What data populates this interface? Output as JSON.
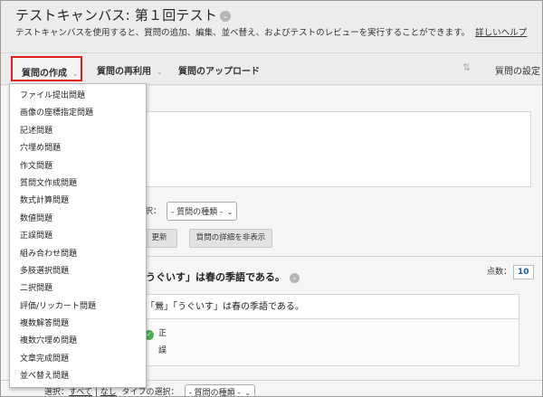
{
  "header": {
    "title": "テストキャンバス: 第１回テスト",
    "subtitle": "テストキャンバスを使用すると、質問の追加、編集、並べ替え、およびテストのレビューを実行することができます。",
    "help_link": "詳しいヘルプ"
  },
  "toolbar": {
    "create_question": "質問の作成",
    "reuse_question": "質問の再利用",
    "upload_questions": "質問のアップロード",
    "sort_icon": "⇅",
    "question_settings": "質問の設定"
  },
  "dropdown": {
    "items": [
      "ファイル提出問題",
      "画像の座標指定問題",
      "記述問題",
      "穴埋め問題",
      "作文問題",
      "質問文作成問題",
      "数式計算問題",
      "数値問題",
      "正誤問題",
      "組み合わせ問題",
      "多肢選択問題",
      "二択問題",
      "評価/リッカート問題",
      "複数解答問題",
      "複数穴埋め問題",
      "文章完成問題",
      "並べ替え問題"
    ]
  },
  "filter": {
    "type_label_partial": "の選択：",
    "type_select": "- 質問の種類 -",
    "update_button": "更新",
    "hide_details_button": "質問の詳細を非表示"
  },
  "question": {
    "title_partial": "「うぐいす」は春の季語である。",
    "points_label": "点数：",
    "points_value": "10",
    "body_partial": "「鶯」「うぐいす」は春の季語である。",
    "answers": [
      "正",
      "誤"
    ]
  },
  "bottom_filter": {
    "select_label": "選択：",
    "all_link": "すべて",
    "none_link": "なし",
    "type_label": "タイプの選択：",
    "type_select": "- 質問の種類 -"
  },
  "colors": {
    "highlight_border": "#e0201a",
    "points_text": "#1b5aa0",
    "correct_check": "#4caf50"
  }
}
